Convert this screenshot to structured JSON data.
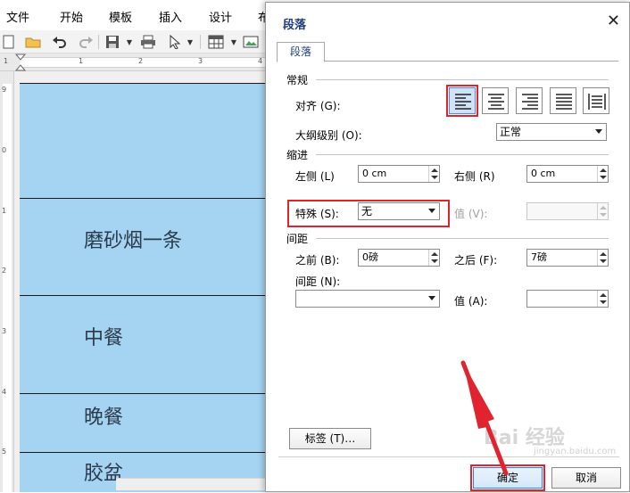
{
  "menu": {
    "items": [
      "文件",
      "开始",
      "模板",
      "插入",
      "设计",
      "布"
    ]
  },
  "toolbar": {
    "icons": [
      "new-icon",
      "open-icon",
      "undo-icon",
      "redo-icon",
      "save-icon",
      "print-icon",
      "pointer-icon",
      "table-icon",
      "image-icon"
    ]
  },
  "ruler": {
    "h_numbers": [
      "1",
      "1",
      "2",
      "3",
      "4"
    ],
    "v_numbers": [
      "9",
      "0",
      "1",
      "2",
      "3",
      "4",
      "5"
    ]
  },
  "document": {
    "cells": [
      "磨砂烟一条",
      "中餐",
      "晚餐",
      "胶盆"
    ],
    "cell_color": "#a4d4f2"
  },
  "dialog": {
    "title": "段落",
    "close_glyph": "✕",
    "tab_label": "段落",
    "section_general": "常规",
    "align_label": "对齐 (G):",
    "outline_label": "大纲级别 (O):",
    "outline_value": "正常",
    "section_indent": "缩进",
    "left_label": "左侧 (L)",
    "left_value": "0 cm",
    "right_label": "右侧 (R)",
    "right_value": "0 cm",
    "special_label": "特殊 (S):",
    "special_value": "无",
    "value_v_label": "值 (V):",
    "section_spacing": "间距",
    "before_label": "之前 (B):",
    "before_value": "0磅",
    "after_label": "之后 (F):",
    "after_value": "7磅",
    "spacing_label": "间距 (N):",
    "value_a_label": "值 (A):",
    "tabs_button": "标签 (T)…",
    "ok_button": "确定",
    "cancel_button": "取消",
    "align_options": [
      "left",
      "center",
      "right",
      "justify",
      "distributed"
    ],
    "align_selected": "left"
  },
  "watermark": {
    "text": "Bai 经验",
    "sub": "jingyan.baidu.com"
  },
  "colors": {
    "highlight_red": "#e0232e",
    "title_blue": "#1d3c7a",
    "selected_fill": "#cfe2f7"
  }
}
